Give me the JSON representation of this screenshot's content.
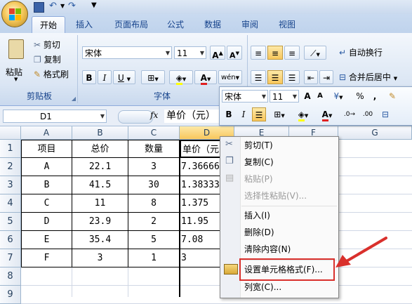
{
  "ribbon": {
    "tabs": [
      "开始",
      "插入",
      "页面布局",
      "公式",
      "数据",
      "审阅",
      "视图"
    ],
    "clipboard": {
      "paste": "粘贴",
      "cut": "剪切",
      "copy": "复制",
      "format_painter": "格式刷",
      "label": "剪贴板"
    },
    "font": {
      "name": "宋体",
      "size": "11",
      "bold": "B",
      "italic": "I",
      "underline": "U",
      "label": "字体"
    },
    "alignment": {
      "wrap": "自动换行",
      "merge": "合并后居中"
    }
  },
  "formula_bar": {
    "name_box": "D1",
    "fx": "fx",
    "content": "单价（元）"
  },
  "sheet": {
    "columns": [
      "A",
      "B",
      "C",
      "D",
      "E",
      "F",
      "G"
    ],
    "rows": [
      "1",
      "2",
      "3",
      "4",
      "5",
      "6",
      "7",
      "8",
      "9"
    ],
    "data": [
      [
        "项目",
        "总价",
        "数量",
        "单价（元"
      ],
      [
        "A",
        "22.1",
        "3",
        "7.36666"
      ],
      [
        "B",
        "41.5",
        "30",
        "1.38333"
      ],
      [
        "C",
        "11",
        "8",
        "1.375"
      ],
      [
        "D",
        "23.9",
        "2",
        "11.95"
      ],
      [
        "E",
        "35.4",
        "5",
        "7.08"
      ],
      [
        "F",
        "3",
        "1",
        "3"
      ]
    ]
  },
  "mini_toolbar": {
    "font": "宋体",
    "size": "11",
    "bold": "B",
    "italic": "I",
    "percent": "%",
    "comma": ","
  },
  "context_menu": {
    "items": [
      {
        "label": "剪切(T)",
        "disabled": false
      },
      {
        "label": "复制(C)",
        "disabled": false
      },
      {
        "label": "粘贴(P)",
        "disabled": true
      },
      {
        "label": "选择性粘贴(V)...",
        "disabled": true
      },
      {
        "label": "插入(I)",
        "disabled": false
      },
      {
        "label": "删除(D)",
        "disabled": false
      },
      {
        "label": "清除内容(N)",
        "disabled": false
      },
      {
        "label": "设置单元格格式(F)...",
        "disabled": false
      },
      {
        "label": "列宽(C)...",
        "disabled": false
      }
    ]
  },
  "colors": {
    "highlight_box": "#d9302c",
    "arrow": "#d9302c"
  }
}
